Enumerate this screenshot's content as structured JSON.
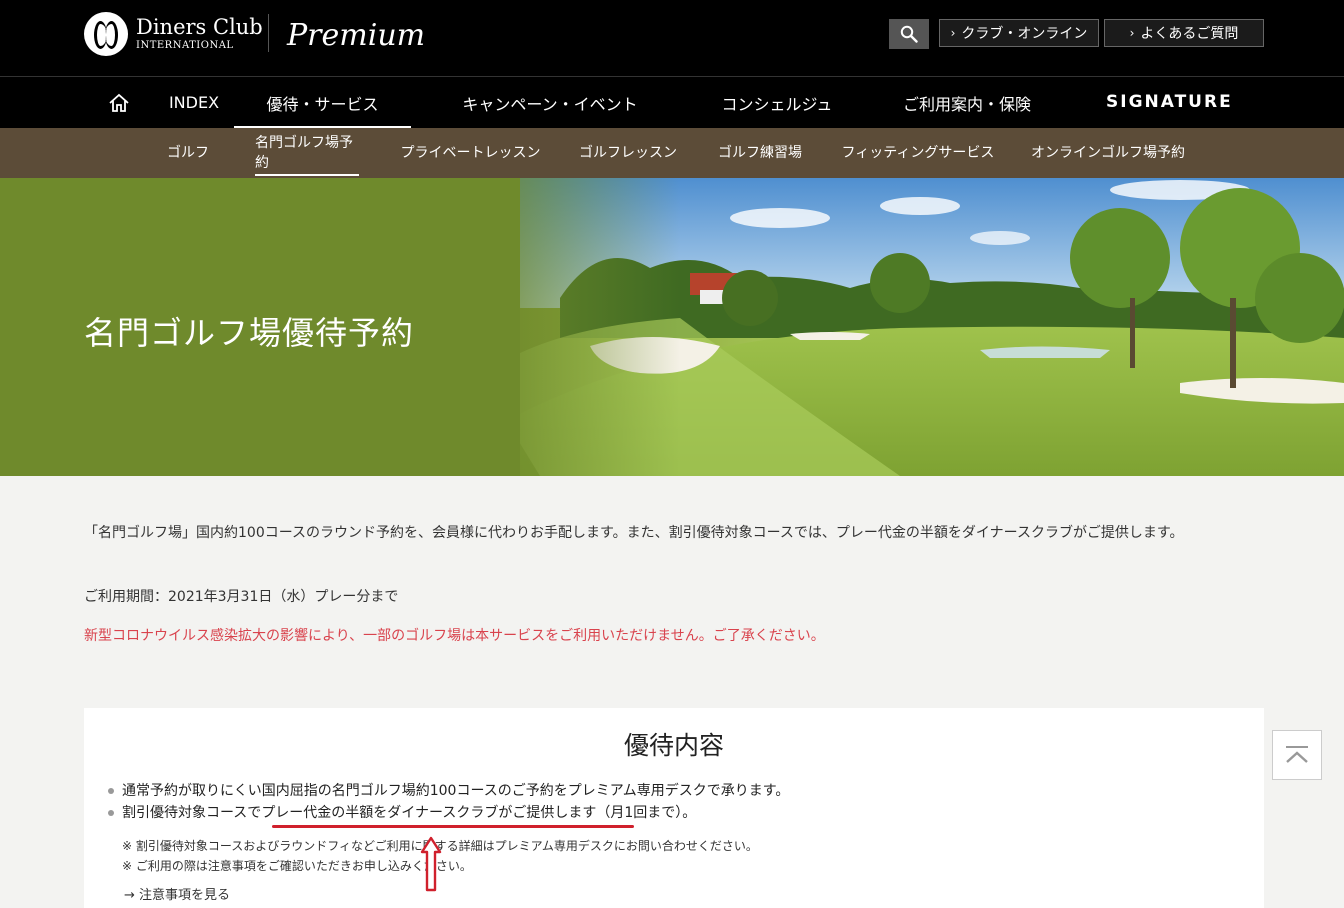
{
  "header": {
    "logo_line1": "Diners Club",
    "logo_line2": "INTERNATIONAL",
    "premium": "Premium",
    "links": [
      {
        "label": "クラブ・オンライン"
      },
      {
        "label": "よくあるご質問"
      }
    ]
  },
  "main_nav": {
    "items": [
      {
        "label": "INDEX"
      },
      {
        "label": "優待・サービス",
        "active": true
      },
      {
        "label": "キャンペーン・イベント"
      },
      {
        "label": "コンシェルジュ"
      },
      {
        "label": "ご利用案内・保険"
      }
    ],
    "signature": "SIGNATURE"
  },
  "sub_nav": {
    "items": [
      {
        "label": "ゴルフ"
      },
      {
        "label": "名門ゴルフ場予約",
        "active": true
      },
      {
        "label": "プライベートレッスン"
      },
      {
        "label": "ゴルフレッスン"
      },
      {
        "label": "ゴルフ練習場"
      },
      {
        "label": "フィッティングサービス"
      },
      {
        "label": "オンラインゴルフ場予約"
      }
    ]
  },
  "hero": {
    "title": "名門ゴルフ場優待予約"
  },
  "content": {
    "intro": "「名門ゴルフ場」国内約100コースのラウンド予約を、会員様に代わりお手配します。また、割引優待対象コースでは、プレー代金の半額をダイナースクラブがご提供します。",
    "period": "ご利用期間：2021年3月31日（水）プレー分まで",
    "notice": "新型コロナウイルス感染拡大の影響により、一部のゴルフ場は本サービスをご利用いただけません。ご了承ください。"
  },
  "benefits": {
    "title": "優待内容",
    "bullet1": "通常予約が取りにくい国内屈指の名門ゴルフ場約100コースのご予約をプレミアム専用デスクで承ります。",
    "bullet2_prefix": "割引優待対象コースで",
    "bullet2_highlight": "プレー代金の半額をダイナースクラブがご提供します",
    "bullet2_suffix": "（月1回まで）。",
    "note1": "※ 割引優待対象コースおよびラウンドフィなどご利用に関する詳細はプレミアム専用デスクにお問い合わせください。",
    "note2": "※ ご利用の際は注意事項をご確認いただきお申し込みください。",
    "more": "→ 注意事項を見る"
  },
  "colors": {
    "accent_red": "#d0202c",
    "subnav_brown": "#5c4c38",
    "notice_red": "#d9434d"
  }
}
